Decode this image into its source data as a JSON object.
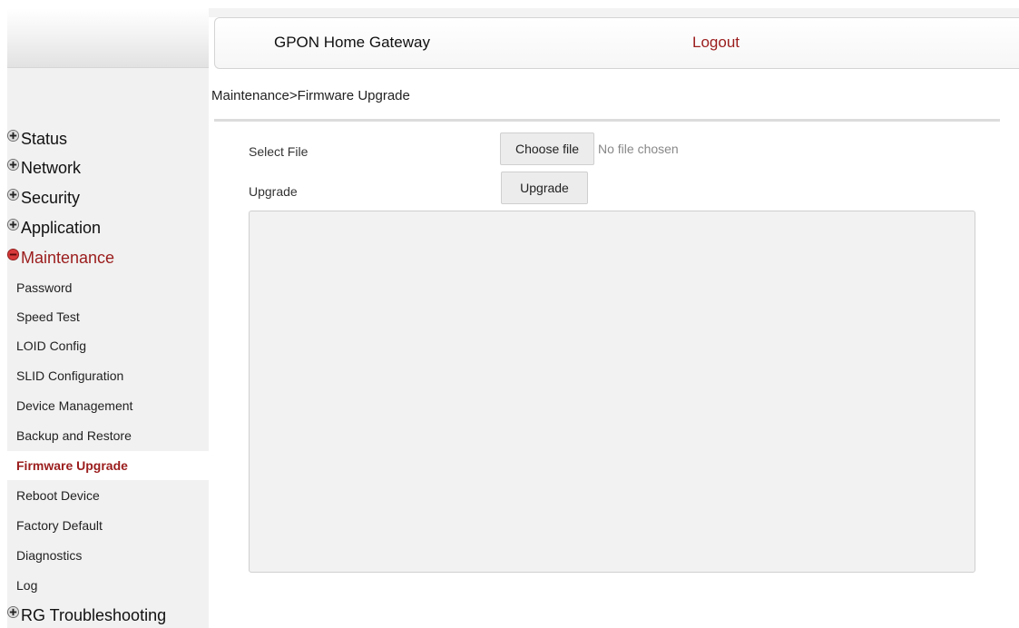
{
  "header": {
    "title": "GPON Home Gateway",
    "logout_label": "Logout"
  },
  "breadcrumb": "Maintenance>Firmware Upgrade",
  "colors": {
    "accent": "#9b1c1c",
    "sidebar_bg": "#f1f1f1",
    "button_bg": "#ececec"
  },
  "sidebar": {
    "menus": [
      {
        "label": "Status",
        "icon": "plus-circle-icon"
      },
      {
        "label": "Network",
        "icon": "plus-circle-icon"
      },
      {
        "label": "Security",
        "icon": "plus-circle-icon"
      },
      {
        "label": "Application",
        "icon": "plus-circle-icon"
      },
      {
        "label": "Maintenance",
        "icon": "minus-circle-icon",
        "active": true
      }
    ],
    "submenu": [
      "Password",
      "Speed Test",
      "LOID Config",
      "SLID Configuration",
      "Device Management",
      "Backup and Restore",
      "Firmware Upgrade",
      "Reboot Device",
      "Factory Default",
      "Diagnostics",
      "Log"
    ],
    "selected_submenu": "Firmware Upgrade",
    "last_menu": {
      "label": "RG Troubleshooting",
      "icon": "plus-circle-icon"
    }
  },
  "form": {
    "select_file_label": "Select File",
    "choose_file_button": "Choose file",
    "no_file_text": "No file chosen",
    "upgrade_label": "Upgrade",
    "upgrade_button": "Upgrade"
  }
}
